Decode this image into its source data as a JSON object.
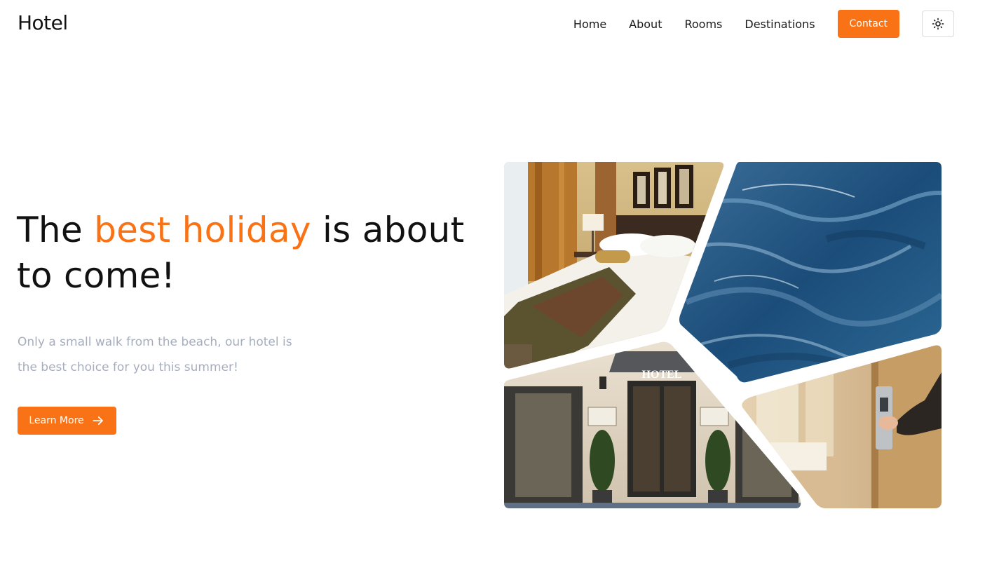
{
  "brand": {
    "logo": "Hotel"
  },
  "nav": {
    "links": [
      "Home",
      "About",
      "Rooms",
      "Destinations"
    ],
    "contact_label": "Contact",
    "theme_icon": "sun-icon"
  },
  "hero": {
    "title_start": "The ",
    "title_accent": "best holiday",
    "title_end": " is about to come!",
    "subtitle": "Only a small walk from the beach, our hotel is the best choice for you this summer!",
    "button_label": "Learn More",
    "button_icon": "arrow-right-icon"
  },
  "gallery": {
    "images": [
      "hotel-bedroom-photo",
      "ocean-wave-photo",
      "hotel-entrance-photo",
      "door-keycard-photo"
    ],
    "entrance_sign": "HOTEL"
  },
  "colors": {
    "accent": "#f97316",
    "subtitle": "#a6adbd",
    "text": "#111111"
  }
}
